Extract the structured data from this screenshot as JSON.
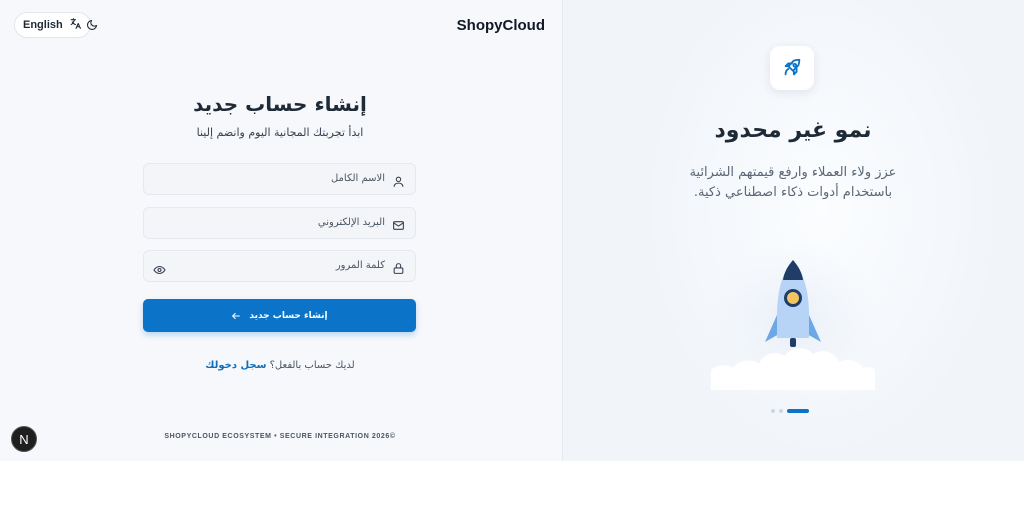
{
  "header": {
    "language_label": "English",
    "brand": "ShopyCloud"
  },
  "form": {
    "title": "إنشاء حساب جديد",
    "subtitle": "ابدأ تجربتك المجانية اليوم وانضم إلينا",
    "fullname_placeholder": "الاسم الكامل",
    "email_placeholder": "البريد الإلكتروني",
    "password_placeholder": "كلمة المرور",
    "submit_label": "إنشاء حساب جديد",
    "have_account_text": "لديك حساب بالفعل؟",
    "login_link": "سجل دخولك"
  },
  "footer": {
    "text": "SHOPYCLOUD ECOSYSTEM • SECURE INTEGRATION 2026©",
    "badge": "N"
  },
  "promo": {
    "title": "نمو غير محدود",
    "description": "عزز ولاء العملاء وارفع قيمتهم الشرائية باستخدام أدوات ذكاء اصطناعي ذكية.",
    "slides_total": 3,
    "active_slide": 3
  },
  "colors": {
    "accent": "#0b74c9",
    "background_left": "#f6f8fb",
    "background_right": "#f1f5fa"
  },
  "icons": {
    "language": "translate-icon",
    "theme": "moon-icon",
    "user": "user-icon",
    "email": "mail-icon",
    "password": "lock-icon",
    "show_password": "eye-icon",
    "submit": "arrow-left-icon",
    "promo": "rocket-icon"
  }
}
